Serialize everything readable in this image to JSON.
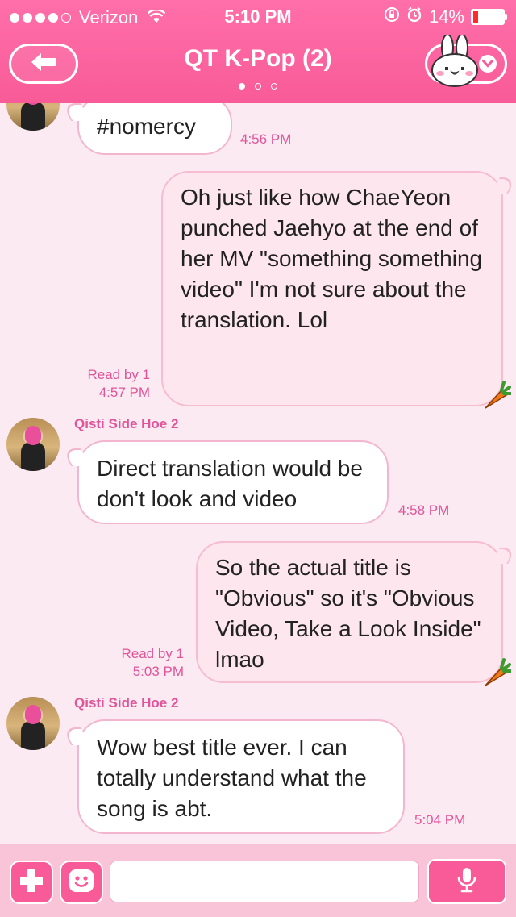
{
  "status_bar": {
    "carrier": "Verizon",
    "time": "5:10 PM",
    "battery": "14%",
    "battery_level": 0.14
  },
  "header": {
    "title": "QT K-Pop (2)",
    "page_count": 3,
    "active_page": 1,
    "back_icon": "arrow-left-icon",
    "sticker_icon": "bunny-sticker-icon"
  },
  "messages": [
    {
      "direction": "incoming",
      "sender": "",
      "text": "#nomercy",
      "time": "4:56 PM"
    },
    {
      "direction": "outgoing",
      "text": "Oh just like how ChaeYeon punched Jaehyo at the end of her MV \"something something video\" I'm not sure about the translation. Lol",
      "read": "Read by 1",
      "time": "4:57 PM"
    },
    {
      "direction": "incoming",
      "sender": "Qisti Side Hoe 2",
      "text": "Direct translation would be don't look and video",
      "time": "4:58 PM"
    },
    {
      "direction": "outgoing",
      "text": "So the actual title is \"Obvious\" so it's \"Obvious Video, Take a Look Inside\" lmao",
      "read": "Read by 1",
      "time": "5:03 PM"
    },
    {
      "direction": "incoming",
      "sender": "Qisti Side Hoe 2",
      "text": "Wow best title ever. I can totally understand what the song is abt.",
      "time": "5:04 PM"
    }
  ],
  "input_bar": {
    "placeholder": "",
    "value": ""
  },
  "colors": {
    "accent": "#f85b98",
    "background": "#fbeaf1",
    "meta_text": "#e0559a"
  }
}
